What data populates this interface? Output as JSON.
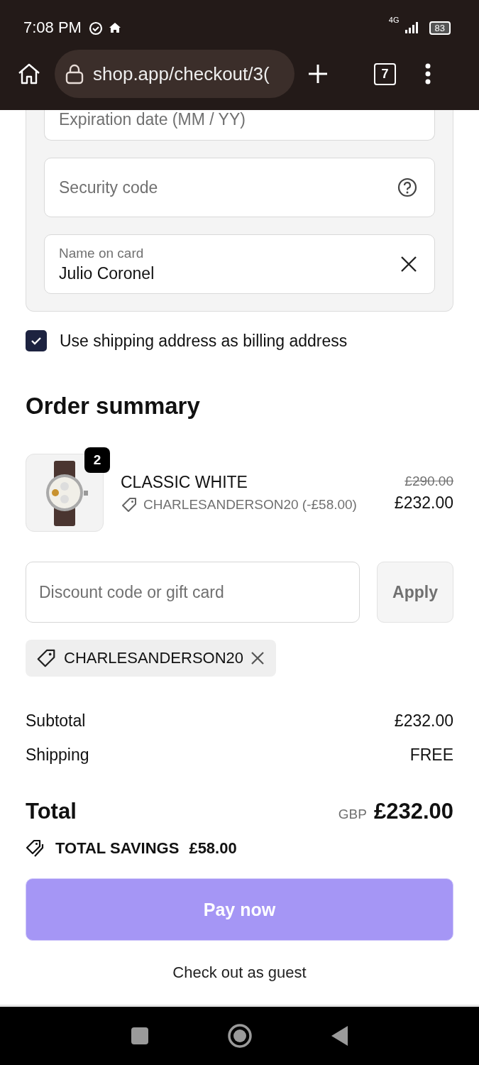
{
  "status_bar": {
    "time": "7:08 PM",
    "network": "4G",
    "battery": "83"
  },
  "browser": {
    "url": "shop.app/checkout/3(",
    "tab_count": "7"
  },
  "card_form": {
    "expiration": {
      "placeholder": "Expiration date (MM / YY)"
    },
    "security": {
      "placeholder": "Security code"
    },
    "name": {
      "label": "Name on card",
      "value": "Julio Coronel"
    }
  },
  "billing_checkbox": {
    "label": "Use shipping address as billing address",
    "checked": true
  },
  "order_summary": {
    "title": "Order summary",
    "items": [
      {
        "name": "CLASSIC WHITE",
        "quantity": "2",
        "discount_code": "CHARLESANDERSON20 (-£58.00)",
        "original_price": "£290.00",
        "price": "£232.00"
      }
    ],
    "discount_field": {
      "placeholder": "Discount code or gift card",
      "button": "Apply"
    },
    "applied_codes": [
      {
        "code": "CHARLESANDERSON20"
      }
    ],
    "lines": [
      {
        "label": "Subtotal",
        "value": "£232.00"
      },
      {
        "label": "Shipping",
        "value": "FREE"
      }
    ],
    "total": {
      "label": "Total",
      "currency": "GBP",
      "amount": "£232.00"
    },
    "savings": {
      "label": "TOTAL SAVINGS",
      "amount": "£58.00"
    },
    "pay_button": "Pay now",
    "guest_link": "Check out as guest"
  }
}
